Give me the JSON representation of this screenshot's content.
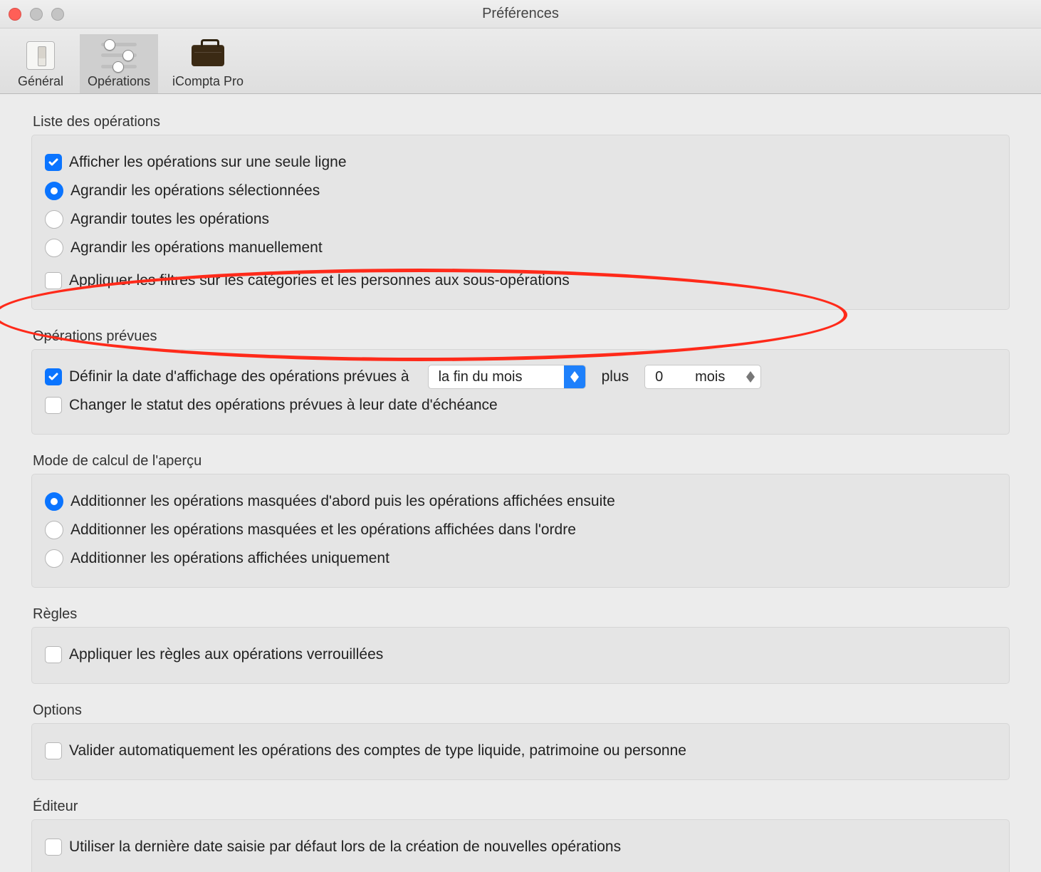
{
  "window": {
    "title": "Préférences"
  },
  "toolbar": {
    "items": [
      {
        "label": "Général"
      },
      {
        "label": "Opérations"
      },
      {
        "label": "iCompta Pro"
      }
    ],
    "selected_index": 1
  },
  "groups": {
    "operations_list": {
      "title": "Liste des opérations",
      "single_line": {
        "label": "Afficher les opérations sur une seule ligne",
        "checked": true
      },
      "expand_mode": {
        "selected_index": 0,
        "options": [
          "Agrandir les opérations sélectionnées",
          "Agrandir toutes les opérations",
          "Agrandir les opérations manuellement"
        ]
      },
      "apply_filters": {
        "label": "Appliquer les filtres sur les catégories et les personnes aux sous-opérations",
        "checked": false
      }
    },
    "scheduled": {
      "title": "Opérations prévues",
      "define_date": {
        "label": "Définir la date d'affichage des opérations prévues à",
        "checked": true,
        "period_value": "la fin du mois",
        "plus_word": "plus",
        "offset_value": "0",
        "offset_unit": "mois"
      },
      "change_status": {
        "label": "Changer le statut des opérations prévues à leur date d'échéance",
        "checked": false
      }
    },
    "preview_mode": {
      "title": "Mode de calcul de l'aperçu",
      "selected_index": 0,
      "options": [
        "Additionner les opérations masquées d'abord puis les opérations affichées ensuite",
        "Additionner les opérations masquées et les opérations affichées dans l'ordre",
        "Additionner les opérations affichées uniquement"
      ]
    },
    "rules": {
      "title": "Règles",
      "apply_locked": {
        "label": "Appliquer les règles aux opérations verrouillées",
        "checked": false
      }
    },
    "options": {
      "title": "Options",
      "auto_validate": {
        "label": "Valider automatiquement les opérations des comptes de type liquide, patrimoine ou personne",
        "checked": false
      }
    },
    "editor": {
      "title": "Éditeur",
      "use_last_date": {
        "label": "Utiliser la dernière date saisie par défaut lors de la création de nouvelles opérations",
        "checked": false
      }
    }
  }
}
